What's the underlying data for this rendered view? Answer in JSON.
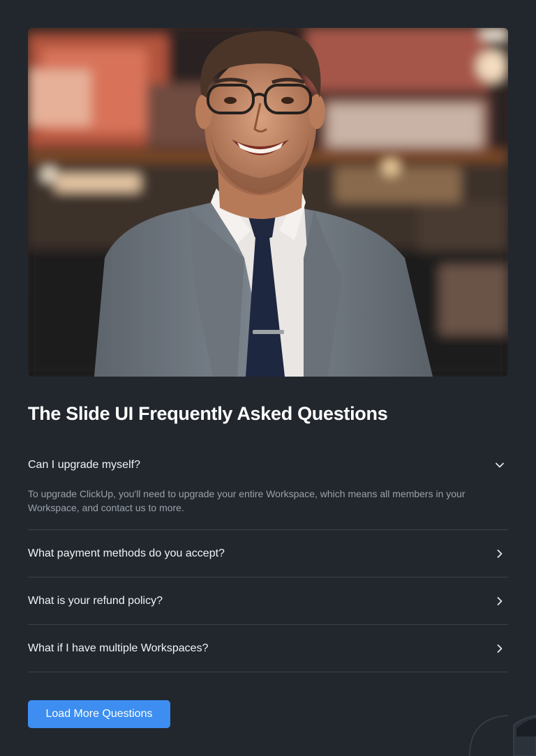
{
  "hero": {
    "image": "portrait of smiling man in glasses, gray suit and navy tie in a blurred venue"
  },
  "faq_section": {
    "title": "The Slide UI Frequently Asked Questions",
    "items": [
      {
        "question": "Can I upgrade myself?",
        "answer": "To upgrade ClickUp, you'll need to upgrade your entire Workspace, which means all members in your Workspace, and contact us to more.",
        "expanded": true,
        "icon": "chevron-down-icon"
      },
      {
        "question": "What payment methods do you accept?",
        "expanded": false,
        "icon": "chevron-right-icon"
      },
      {
        "question": "What is your refund policy?",
        "expanded": false,
        "icon": "chevron-right-icon"
      },
      {
        "question": "What if I have multiple Workspaces?",
        "expanded": false,
        "icon": "chevron-right-icon"
      }
    ]
  },
  "load_more": {
    "label": "Load More Questions"
  },
  "colors": {
    "background": "#22272e",
    "accent": "#3d8ef0",
    "divider": "#3b4149",
    "answer_text": "#9aa1a9"
  }
}
